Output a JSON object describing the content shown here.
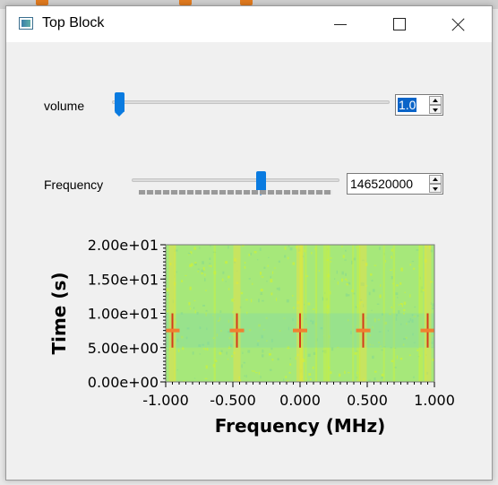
{
  "window": {
    "title": "Top Block"
  },
  "controls": {
    "volume": {
      "label": "volume",
      "value": "1.0",
      "slider_fraction": 0.01
    },
    "frequency": {
      "label": "Frequency",
      "value": "146520000",
      "slider_fraction": 0.62
    }
  },
  "plot": {
    "type": "waterfall",
    "xlabel": "Frequency (MHz)",
    "ylabel": "Time (s)",
    "x_ticks": [
      "-1.000",
      "-0.500",
      "0.000",
      "0.500",
      "1.000"
    ],
    "y_ticks": [
      "2.00e+01",
      "1.50e+01",
      "1.00e+01",
      "5.00e+00",
      "0.00e+00"
    ],
    "xlim": [
      -1.0,
      1.0
    ],
    "ylim": [
      0.0,
      20.0
    ],
    "signal_frequencies_mhz": [
      -0.95,
      -0.47,
      0.0,
      0.47,
      0.95
    ],
    "signal_time_range_s": [
      5.0,
      10.0
    ],
    "colors": {
      "background": "#a6e87a",
      "noise": "#c8f040",
      "signal": "#d63a1a",
      "band": "#7fd8b0"
    }
  }
}
